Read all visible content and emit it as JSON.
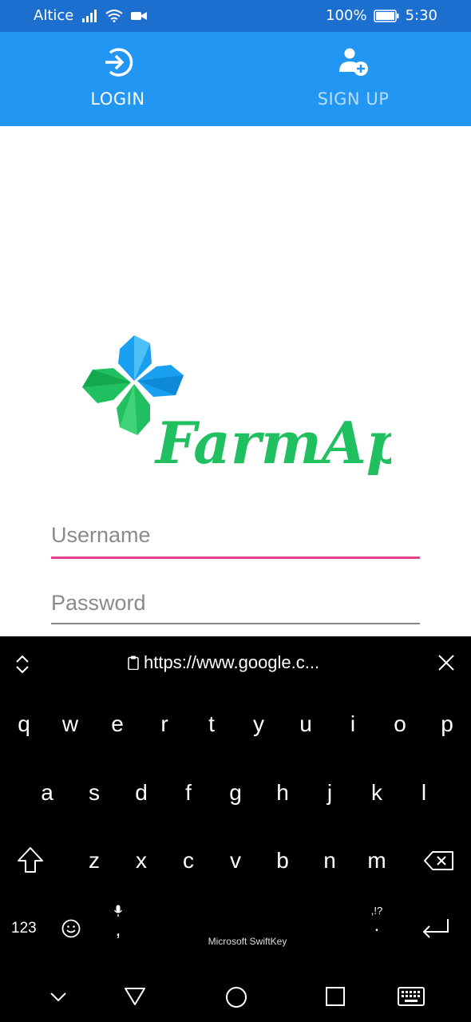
{
  "status_bar": {
    "carrier": "Altice",
    "battery": "100%",
    "time": "5:30"
  },
  "tabs": [
    {
      "label": "LOGIN",
      "icon": "login-icon",
      "active": true
    },
    {
      "label": "SIGN UP",
      "icon": "add-user-icon",
      "active": false
    }
  ],
  "logo": {
    "text": "FarmApp"
  },
  "form": {
    "username_placeholder": "Username",
    "password_placeholder": "Password"
  },
  "keyboard": {
    "url": "https://www.google.c...",
    "row1": [
      "q",
      "w",
      "e",
      "r",
      "t",
      "y",
      "u",
      "i",
      "o",
      "p"
    ],
    "row2": [
      "a",
      "s",
      "d",
      "f",
      "g",
      "h",
      "j",
      "k",
      "l"
    ],
    "row3": [
      "z",
      "x",
      "c",
      "v",
      "b",
      "n",
      "m"
    ],
    "numbers_label": "123",
    "brand": "Microsoft SwiftKey",
    "comma": ",",
    "period": ".",
    "punct_hint": ",!?"
  },
  "colors": {
    "status_bar": "#1c6fcf",
    "tab_bar": "#2196f3",
    "focus_underline": "#e53e8a",
    "logo_green": "#20c060",
    "logo_blue": "#1aa0f0"
  }
}
